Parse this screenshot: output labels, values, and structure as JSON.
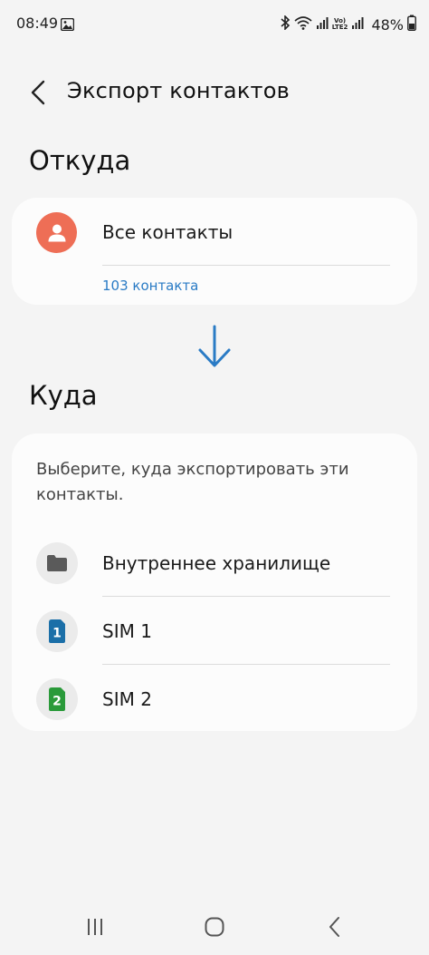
{
  "status_bar": {
    "time": "08:49",
    "lte_top": "Vo)",
    "lte_bottom": "LTE2",
    "battery_text": "48%",
    "icons": [
      "gallery-icon",
      "bluetooth-icon",
      "wifi-icon",
      "signal-icon",
      "signal-icon",
      "battery-icon"
    ]
  },
  "app_bar": {
    "title": "Экспорт контактов",
    "back_icon": "chevron-left-icon"
  },
  "source": {
    "heading": "Откуда",
    "item_label": "Все контакты",
    "item_icon": "person-icon",
    "count_text": "103 контакта",
    "avatar_color": "#ee6e56",
    "count_color": "#2a7bc5"
  },
  "arrow_icon": "arrow-down-icon",
  "destination": {
    "heading": "Куда",
    "description": "Выберите, куда экспортировать эти контакты.",
    "options": [
      {
        "label": "Внутреннее хранилище",
        "icon": "folder-icon"
      },
      {
        "label": "SIM 1",
        "icon": "sim1-icon",
        "badge": "1",
        "color": "#1b6fa8"
      },
      {
        "label": "SIM 2",
        "icon": "sim2-icon",
        "badge": "2",
        "color": "#2a9a3a"
      }
    ]
  },
  "nav_bar": {
    "icons": [
      "recent-apps-icon",
      "home-icon",
      "back-icon"
    ]
  }
}
